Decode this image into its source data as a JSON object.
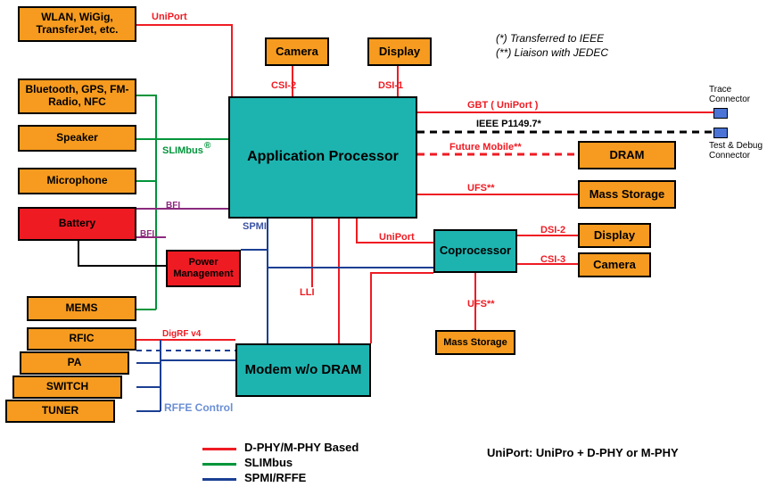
{
  "notes": {
    "ieee": "(*) Transferred to IEEE",
    "jedec": "(**) Liaison with JEDEC"
  },
  "blocks": {
    "wlan": "WLAN, WiGig, TransferJet, etc.",
    "bt": "Bluetooth, GPS, FM-Radio, NFC",
    "speaker": "Speaker",
    "microphone": "Microphone",
    "battery": "Battery",
    "mems": "MEMS",
    "rfic": "RFIC",
    "pa": "PA",
    "switch": "SWITCH",
    "tuner": "TUNER",
    "camera_top": "Camera",
    "display_top": "Display",
    "app_proc": "Application Processor",
    "power_mgmt": "Power Management",
    "modem": "Modem w/o DRAM",
    "coprocessor": "Coprocessor",
    "dram": "DRAM",
    "mass_storage": "Mass Storage",
    "display_r": "Display",
    "camera_r": "Camera",
    "mass_storage2": "Mass Storage"
  },
  "labels": {
    "uniport_top": "UniPort",
    "slimbus": "SLIMbus",
    "slimbus_reg": "®",
    "bfi1": "BFI",
    "bfi2": "BFI",
    "spmi": "SPMI",
    "digrf": "DigRF v4",
    "rffe": "RFFE Control",
    "csi2": "CSI-2",
    "dsi1": "DSI-1",
    "gbt": "GBT ( UniPort )",
    "ieee_p": "IEEE P1149.7*",
    "future_mobile": "Future Mobile**",
    "ufs1": "UFS**",
    "uniport_mid": "UniPort",
    "lli": "LLI",
    "dsi2": "DSI-2",
    "csi3": "CSI-3",
    "ufs2": "UFS**",
    "trace_conn": "Trace Connector",
    "debug_conn": "Test & Debug Connector"
  },
  "legend": {
    "dphy": "D-PHY/M-PHY Based",
    "slimbus": "SLIMbus",
    "spmi": "SPMI/RFFE",
    "uniport": "UniPort: UniPro + D-PHY or M-PHY"
  },
  "colors": {
    "red": "#ef1b23",
    "green": "#00953a",
    "blue": "#1b3f93",
    "purple": "#8c2a7e",
    "black": "#000000"
  }
}
